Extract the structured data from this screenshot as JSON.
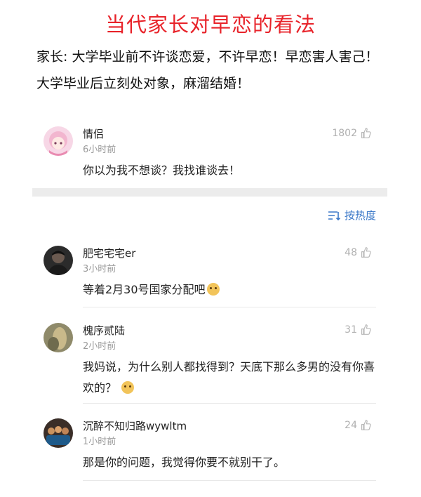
{
  "title": "当代家长对早恋的看法",
  "intro": {
    "line1": "家长: 大学毕业前不许谈恋爱，不许早恋！早恋害人害己！",
    "line2": "大学毕业后立刻处对象，麻溜结婚！"
  },
  "pinned_comment": {
    "username": "情侣",
    "time": "6小时前",
    "likes": "1802",
    "text": "你以为我不想谈？我找谁谈去！"
  },
  "sort": {
    "label": "按热度"
  },
  "comments": [
    {
      "username": "肥宅宅宅er",
      "time": "3小时前",
      "likes": "48",
      "text": "等着2月30号国家分配吧"
    },
    {
      "username": "槐序贰陆",
      "time": "2小时前",
      "likes": "31",
      "text": "我妈说，为什么别人都找得到？天底下那么多男的没有你喜欢的？"
    },
    {
      "username": "沉醉不知归路wywltm",
      "time": "1小时前",
      "likes": "24",
      "text": "那是你的问题，我觉得你要不就别干了。"
    }
  ],
  "colors": {
    "title": "#e8232a",
    "link": "#3b78c8",
    "muted": "#9a9a9a"
  },
  "icons": {
    "like": "thumbs-up-icon",
    "sort": "sort-icon",
    "emoji": "doge-emoji-icon"
  }
}
